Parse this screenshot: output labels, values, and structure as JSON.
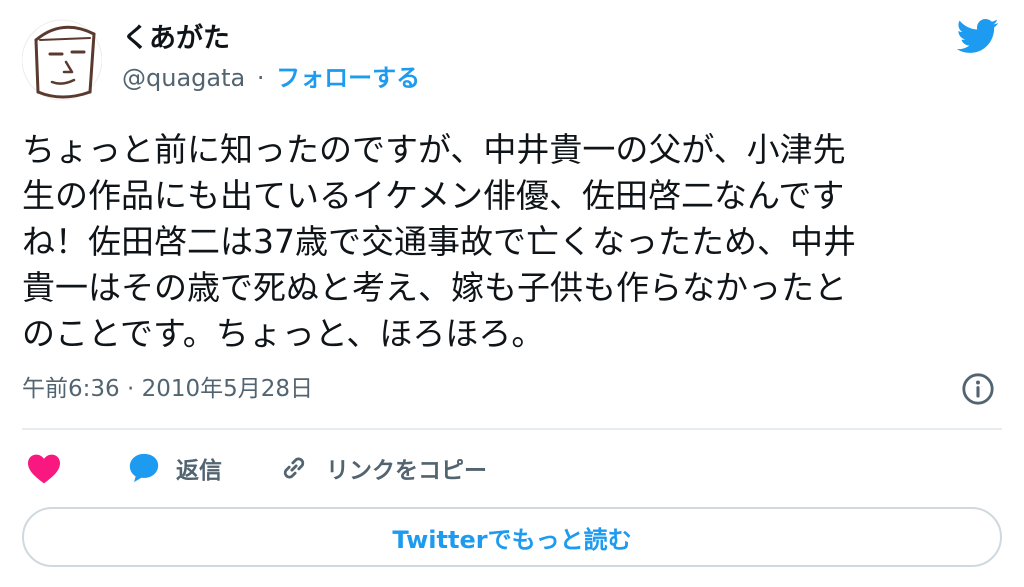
{
  "author": {
    "name": "くあがた",
    "handle": "@quagata",
    "separator": "·",
    "follow_label": "フォローする"
  },
  "icons": {
    "avatar": "hand-drawn-face-avatar",
    "logo": "twitter-bird-icon",
    "info": "info-circle-icon",
    "like": "heart-icon",
    "reply": "speech-bubble-icon",
    "copy": "link-icon"
  },
  "tweet": {
    "lines": [
      "ちょっと前に知ったのですが、中井貴一の父が、小津先",
      "生の作品にも出ているイケメン俳優、佐田啓二なんです",
      "ね！佐田啓二は37歳で交通事故で亡くなったため、中井",
      "貴一はその歳で死ぬと考え、嫁も子供も作らなかったと",
      "のことです。ちょっと、ほろほろ。"
    ],
    "timestamp": "午前6:36 · 2010年5月28日"
  },
  "actions": {
    "reply_label": "返信",
    "copy_link_label": "リンクをコピー"
  },
  "read_more_label": "Twitterでもっと読む",
  "colors": {
    "accent": "#1d9bf0",
    "like": "#f91880",
    "text": "#0f1419",
    "muted": "#536471",
    "border": "#cfd9de"
  }
}
